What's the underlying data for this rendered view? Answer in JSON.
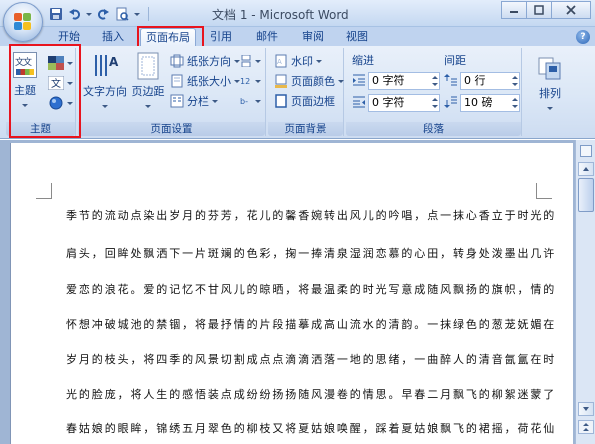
{
  "window": {
    "title": "文档 1 - Microsoft Word"
  },
  "quick_access": {
    "items": [
      "save-icon",
      "undo-icon",
      "redo-icon",
      "print-preview-icon",
      "customize-dropdown-icon"
    ]
  },
  "tabs": [
    {
      "label": "开始",
      "active": false
    },
    {
      "label": "插入",
      "active": false
    },
    {
      "label": "页面布局",
      "active": true
    },
    {
      "label": "引用",
      "active": false
    },
    {
      "label": "邮件",
      "active": false
    },
    {
      "label": "审阅",
      "active": false
    },
    {
      "label": "视图",
      "active": false
    }
  ],
  "ribbon": {
    "theme_group": {
      "label": "主题",
      "button_label": "主题",
      "theme_icon_text": "文文"
    },
    "page_setup": {
      "label": "页面设置",
      "text_direction": "文字方向",
      "margins": "页边距",
      "orientation": "纸张方向",
      "size": "纸张大小",
      "columns": "分栏"
    },
    "page_background": {
      "label": "页面背景",
      "watermark": "水印",
      "page_color": "页面颜色",
      "page_borders": "页面边框"
    },
    "paragraph": {
      "label": "段落",
      "indent_label": "缩进",
      "spacing_label": "间距",
      "indent_left": "0 字符",
      "indent_right": "0 字符",
      "spacing_before": "0 行",
      "spacing_after": "10 磅"
    },
    "arrange": {
      "label": "排列"
    }
  },
  "document": {
    "lines": [
      "季节的流动点染出岁月的芬芳，花儿的馨香婉转出风儿的吟唱，点一抹心香立于时光的",
      "肩头，回眸处飘洒下一片斑斓的色彩，掬一捧清泉湿润恋慕的心田，转身处泼墨出几许",
      "爱恋的浪花。爱的记忆不甘风儿的晾晒，将最温柔的时光写意成随风飘扬的旗帜，情的",
      "怀想冲破城池的禁锢，将最抒情的片段描摹成高山流水的清韵。一抹绿色的葱茏妩媚在",
      "岁月的枝头，将四季的风景切割成点点滴滴洒落一地的思绪，一曲醉人的清音氤氲在时",
      "光的脸庞，将人生的感悟装点成纷纷扬扬随风漫卷的情思。早春二月飘飞的柳絮迷蒙了",
      "春姑娘的眼眸，锦绣五月翠色的柳枝又将夏姑娘唤醒，踩着夏姑娘飘飞的裙摇，荷花仙"
    ]
  },
  "colors": {
    "highlight_box": "#e8141e",
    "ribbon_text": "#15428b",
    "doc_background": "#9fb5d4"
  }
}
